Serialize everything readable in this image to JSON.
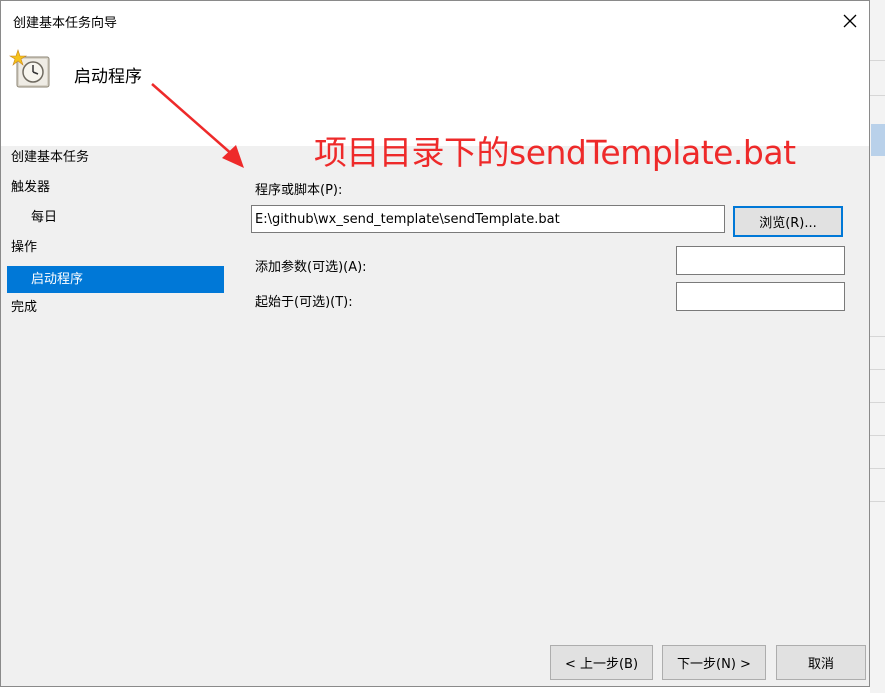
{
  "window": {
    "title": "创建基本任务向导"
  },
  "header": {
    "title": "启动程序",
    "icon": "task-clock-icon"
  },
  "sidebar": {
    "items": [
      {
        "label": "创建基本任务",
        "indent": false,
        "active": false
      },
      {
        "label": "触发器",
        "indent": false,
        "active": false
      },
      {
        "label": "每日",
        "indent": true,
        "active": false
      },
      {
        "label": "操作",
        "indent": false,
        "active": false
      },
      {
        "label": "启动程序",
        "indent": true,
        "active": true
      },
      {
        "label": "完成",
        "indent": false,
        "active": false
      }
    ],
    "active_color": "#0078d7"
  },
  "form": {
    "program_label": "程序或脚本(P):",
    "program_value": "E:\\github\\wx_send_template\\sendTemplate.bat",
    "browse_label": "浏览(R)...",
    "args_label": "添加参数(可选)(A):",
    "args_value": "",
    "startin_label": "起始于(可选)(T):",
    "startin_value": ""
  },
  "footer": {
    "back_label": "< 上一步(B)",
    "next_label": "下一步(N) >",
    "cancel_label": "取消"
  },
  "annotation": {
    "text": "项目目录下的sendTemplate.bat",
    "color": "#ee2a2a"
  }
}
